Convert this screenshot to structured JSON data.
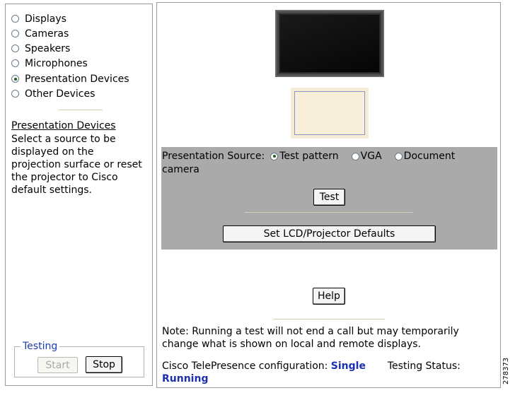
{
  "left_panel": {
    "device_options": [
      {
        "label": "Displays",
        "selected": false
      },
      {
        "label": "Cameras",
        "selected": false
      },
      {
        "label": "Speakers",
        "selected": false
      },
      {
        "label": "Microphones",
        "selected": false
      },
      {
        "label": "Presentation Devices",
        "selected": true
      },
      {
        "label": "Other Devices",
        "selected": false
      }
    ],
    "help_title": "Presentation Devices",
    "help_text": "Select a source to be displayed on the projection surface or reset the projector to Cisco default settings.",
    "testing": {
      "legend": "Testing",
      "start_label": "Start",
      "stop_label": "Stop"
    }
  },
  "main": {
    "source": {
      "label": "Presentation Source:",
      "options": [
        {
          "label": "Test pattern",
          "selected": true
        },
        {
          "label": "VGA",
          "selected": false
        },
        {
          "label": "Document",
          "selected": false
        }
      ],
      "wrap_text": "camera"
    },
    "test_label": "Test",
    "defaults_label": "Set LCD/Projector Defaults",
    "help_label": "Help",
    "note": "Note: Running a test will not end a call but may temporarily change what is shown on local and remote displays.",
    "config_label": "Cisco TelePresence configuration:",
    "config_value": "Single",
    "status_label": "Testing Status:",
    "status_value": "Running"
  },
  "figure_number": "278373",
  "colors": {
    "accent_blue": "#1a2fb3",
    "gray_panel": "#aaaaaa",
    "divider": "#d6ccb4"
  }
}
